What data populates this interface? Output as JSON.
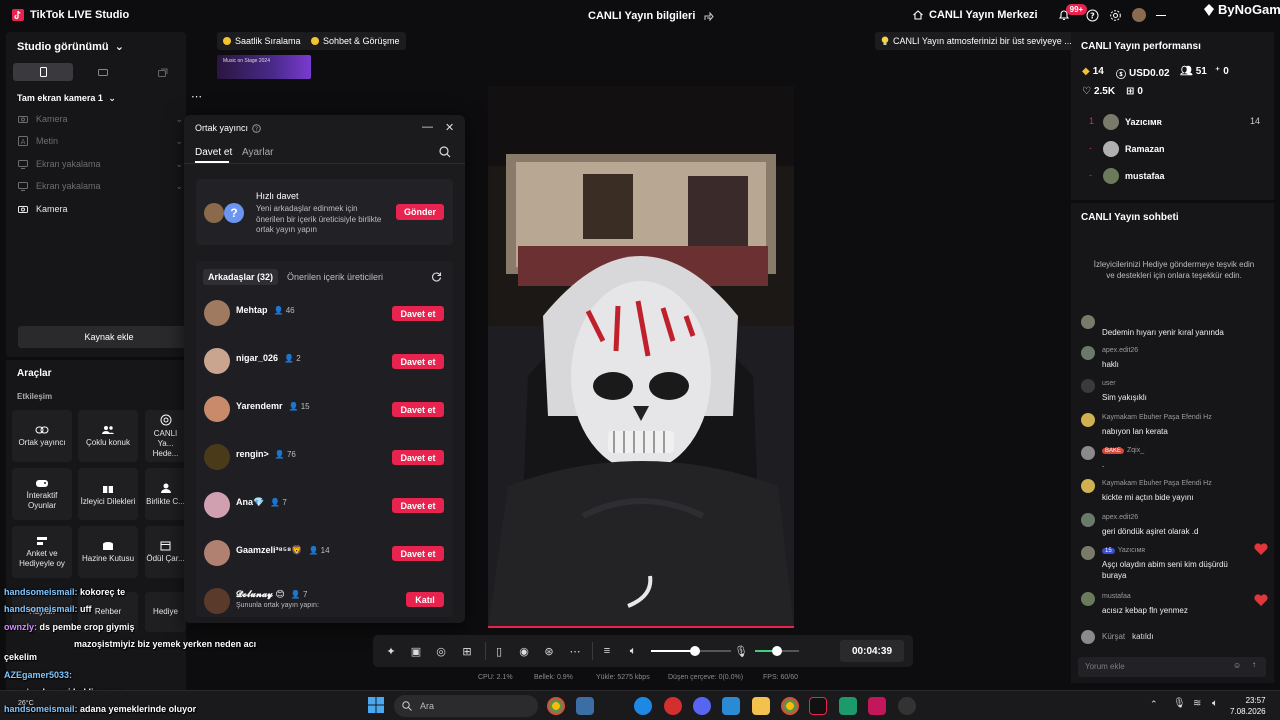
{
  "titlebar": {
    "app_name": "TikTok LIVE Studio",
    "center_title": "CANLI Yayın bilgileri",
    "live_center": "CANLI Yayın Merkezi",
    "notif_badge": "99+",
    "watermark": "ByNoGame"
  },
  "left": {
    "studio_view": "Studio görünümü",
    "scene_name": "Tam ekran kamera 1",
    "sources": [
      {
        "label": "Kamera",
        "enabled": false
      },
      {
        "label": "Metin",
        "enabled": false
      },
      {
        "label": "Ekran yakalama",
        "enabled": false
      },
      {
        "label": "Ekran yakalama",
        "enabled": false
      },
      {
        "label": "Kamera",
        "enabled": true
      }
    ],
    "add_source": "Kaynak ekle"
  },
  "tools": {
    "heading": "Araçlar",
    "section": "Etkileşim",
    "items": [
      {
        "label": "Ortak yayıncı",
        "icon": "link-icon"
      },
      {
        "label": "Çoklu konuk",
        "icon": "users-icon"
      },
      {
        "label": "CANLI Ya... Hede...",
        "icon": "target-icon"
      },
      {
        "label": "İnteraktif Oyunlar",
        "icon": "gamepad-icon"
      },
      {
        "label": "İzleyici Dilekleri",
        "icon": "gift-icon"
      },
      {
        "label": "Birlikte C...",
        "icon": "user-icon"
      },
      {
        "label": "Anket ve Hediyeyle oy",
        "icon": "poll-icon"
      },
      {
        "label": "Hazine Kutusu",
        "icon": "chest-icon"
      },
      {
        "label": "Ödül Çar...",
        "icon": "calendar-icon"
      },
      {
        "label": "Hayran",
        "icon": "heart-icon"
      },
      {
        "label": "Rehber",
        "icon": "book-icon"
      },
      {
        "label": "Hediye",
        "icon": "gift-icon"
      }
    ]
  },
  "chips": {
    "ranking": "Saatlik Sıralama",
    "chat_talk": "Sohbet & Görüşme",
    "tip": "CANLI Yayın atmosferinizi bir üst seviyeye ...",
    "thumb_text": "Music on Stage 2024"
  },
  "popup": {
    "title": "Ortak yayıncı",
    "tab_invite": "Davet et",
    "tab_settings": "Ayarlar",
    "quick_title": "Hızlı davet",
    "quick_desc": "Yeni arkadaşlar edinmek için önerilen bir içerik üreticisiyle birlikte ortak yayın yapın",
    "quick_button": "Gönder",
    "friends_tab": "Arkadaşlar (32)",
    "suggested_tab": "Önerilen içerik üreticileri",
    "friends": [
      {
        "name": "Mehtap",
        "count": "46",
        "button": "Davet et",
        "sub": ""
      },
      {
        "name": "nigar_026",
        "count": "2",
        "button": "Davet et",
        "sub": ""
      },
      {
        "name": "Yarendemr",
        "count": "15",
        "button": "Davet et",
        "sub": ""
      },
      {
        "name": "rengin>",
        "count": "76",
        "button": "Davet et",
        "sub": ""
      },
      {
        "name": "Ana💎",
        "count": "7",
        "button": "Davet et",
        "sub": ""
      },
      {
        "name": "Gaamzeli³⁸⁵⁸🦁",
        "count": "14",
        "button": "Davet et",
        "sub": ""
      },
      {
        "name": "𝓓𝓸𝓵𝓾𝓷𝓪𝔂 😊",
        "count": "7",
        "button": "Katıl",
        "sub": "Şununla ortak yayın yapın:"
      }
    ]
  },
  "controls": {
    "timer": "00:04:39",
    "mic_level": 0.5,
    "volume_level": 0.55
  },
  "status": {
    "cpu": "CPU: 2.1%",
    "memory": "Bellek: 0.9%",
    "upload": "Yükle: 5275 kbps",
    "dropped": "Düşen çerçeve: 0(0.0%)",
    "fps": "FPS: 60/60"
  },
  "performance": {
    "heading": "CANLI Yayın performansı",
    "stats": {
      "diamonds": "14",
      "usd": "USD0.02",
      "viewers": "51",
      "new": "0",
      "likes": "2.5K",
      "gifts": "0"
    },
    "ranking": [
      {
        "rank": "1",
        "name": "Yazıcıᴍʀ",
        "score": "14"
      },
      {
        "rank": "-",
        "name": "Ramazan",
        "score": ""
      },
      {
        "rank": "-",
        "name": "mustafaa",
        "score": ""
      }
    ]
  },
  "chat": {
    "heading": "CANLI Yayın sohbeti",
    "info": "İzleyicilerinizi Hediye göndermeye teşvik edin ve destekleri için onlara teşekkür edin.",
    "messages": [
      {
        "user": "Yazıcıᴍʀ",
        "text": "Dedemin hıyarı yenir kıral yanında",
        "badge": ""
      },
      {
        "user": "apex.edit26",
        "text": "haklı",
        "badge": ""
      },
      {
        "user": "user",
        "text": "Sim yakışıklı",
        "badge": ""
      },
      {
        "user": "Kaymakam Ebuher Paşa Efendi Hz",
        "text": "nabıyon lan kerata",
        "badge": ""
      },
      {
        "user": "Zqix_",
        "text": ".",
        "badge": "BAKE"
      },
      {
        "user": "Kaymakam Ebuher Paşa Efendi Hz",
        "text": "kickte mi açtın bide yayını",
        "badge": ""
      },
      {
        "user": "apex.edit26",
        "text": "geri döndük aşiret olarak .d",
        "badge": ""
      },
      {
        "user": "Yazıcıᴍʀ",
        "text": "Aşçı olaydın abim seni kim düşürdü buraya",
        "badge": "15"
      },
      {
        "user": "mustafaa",
        "text": "acısız kebap fln yenmez",
        "badge": ""
      },
      {
        "user": "Kürşat",
        "text": "katıldı",
        "badge": ""
      }
    ],
    "input_placeholder": "Yorum ekle"
  },
  "overlay_chat": [
    {
      "user": "handsomeismail:",
      "text": "kokoreç te"
    },
    {
      "user": "handsomeismail:",
      "text": "uff"
    },
    {
      "user": "ownzly:",
      "text": "ds pembe crop giymiş"
    },
    {
      "user": "",
      "text": "mazoşistmiyiz biz yemek yerken neden acı"
    },
    {
      "user": "",
      "text": "çekelim"
    },
    {
      "user": "AZEgamer5033:",
      "text": ""
    },
    {
      "user": "ownzly:",
      "text": "ds seni bekliyomuş"
    },
    {
      "user": "handsomeismail:",
      "text": "adana yemeklerinde oluyor"
    }
  ],
  "taskbar": {
    "search": "Ara",
    "time": "23:57",
    "date": "7.08.2026",
    "weather": "26°C"
  }
}
